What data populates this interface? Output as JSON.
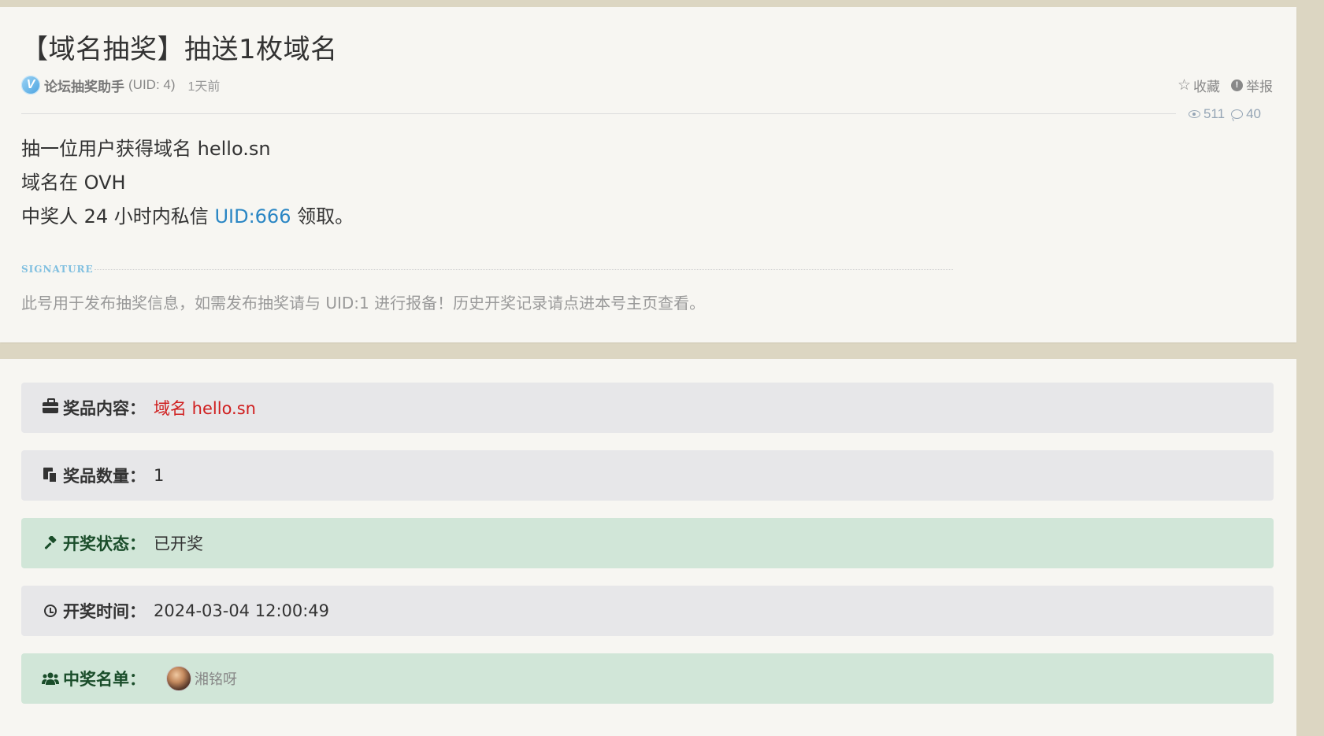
{
  "post": {
    "title": "【域名抽奖】抽送1枚域名",
    "author": {
      "badge_letter": "V",
      "name": "论坛抽奖助手",
      "uid_text": "(UID: 4)",
      "time": "1天前"
    },
    "actions": {
      "favorite_label": "收藏",
      "report_label": "举报",
      "favorite_icon": "star-outline-icon",
      "report_icon": "exclamation-circle-icon"
    },
    "stats": {
      "views": "511",
      "comments": "40"
    },
    "body": {
      "line1": "抽一位用户获得域名 hello.sn",
      "line2": "域名在 OVH",
      "line3_prefix": "中奖人 24 小时内私信 ",
      "line3_link": "UID:666",
      "line3_suffix": " 领取。"
    },
    "signature": {
      "label": "SIGNATURE",
      "text": "此号用于发布抽奖信息，如需发布抽奖请与 UID:1 进行报备！历史开奖记录请点进本号主页查看。"
    }
  },
  "lottery": {
    "prize": {
      "label": "奖品内容：",
      "value": "域名 hello.sn",
      "icon": "briefcase-icon",
      "value_color": "#d01f1f"
    },
    "quantity": {
      "label": "奖品数量：",
      "value": "1",
      "icon": "copy-icon"
    },
    "status": {
      "label": "开奖状态：",
      "value": "已开奖",
      "icon": "gavel-icon"
    },
    "draw_time": {
      "label": "开奖时间：",
      "value": "2024-03-04 12:00:49",
      "icon": "clock-icon"
    },
    "winners": {
      "label": "中奖名单：",
      "icon": "users-icon",
      "list": [
        {
          "name": "湘铭呀"
        }
      ]
    }
  },
  "colors": {
    "page_bg": "#dcd6c2",
    "card_bg": "#f7f6f2",
    "row_gray": "#e7e7e9",
    "row_green": "#d1e6d8",
    "link": "#2a86c4",
    "prize_red": "#d01f1f"
  }
}
